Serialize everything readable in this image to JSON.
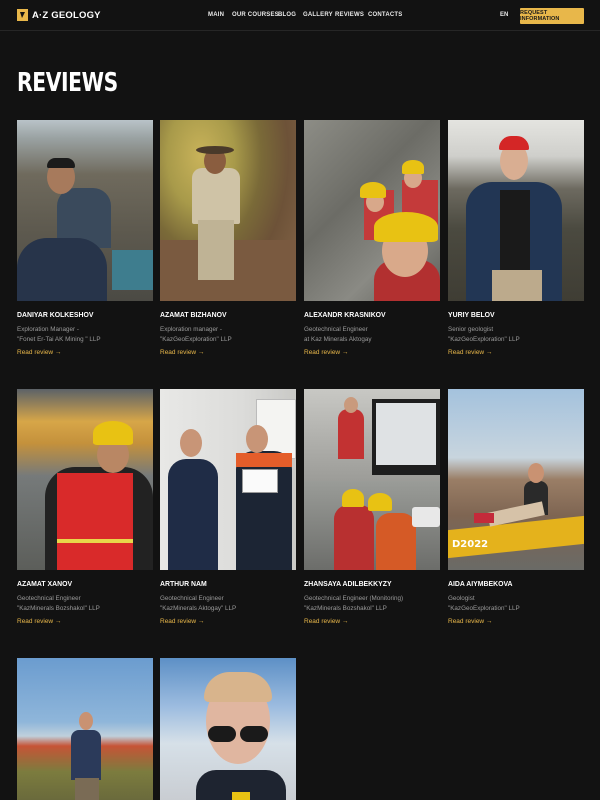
{
  "header": {
    "logo_text": "A·Z GEOLOGY",
    "nav": [
      "MAIN",
      "OUR COURSES",
      "BLOG",
      "GALLERY",
      "REVIEWS",
      "CONTACTS"
    ],
    "lang": "EN",
    "cta_label": "REQUEST INFORMATION"
  },
  "page": {
    "title": "REVIEWS"
  },
  "read_label": "Read review →",
  "reviews": [
    {
      "name": "DANIYAR KOLKESHOV",
      "role1": "Exploration Manager -",
      "role2": "\"Fonet Er-Tai AK Mining \" LLP"
    },
    {
      "name": "AZAMAT BIZHANOV",
      "role1": "Exploration manager -",
      "role2": "\"KazGeoExploration\" LLP"
    },
    {
      "name": "ALEXANDR KRASNIKOV",
      "role1": "Geotechnical Engineer",
      "role2": "at Kaz Minerals Aktogay"
    },
    {
      "name": "YURIY BELOV",
      "role1": "Senior geologist",
      "role2": "\"KazGeoExploration\" LLP"
    },
    {
      "name": "AZAMAT XANOV",
      "role1": "Geotechnical Engineer",
      "role2": "\"KazMinerals Bozshakol\" LLP"
    },
    {
      "name": "ARTHUR NAM",
      "role1": "Geotechnical Engineer",
      "role2": "\"KazMinerals Aktogay\" LLP"
    },
    {
      "name": "ZHANSAYA ADILBEKKYZY",
      "role1": "Geotechnical Engineer (Monitoring)",
      "role2": "\"KazMinerals Bozshakol\" LLP"
    },
    {
      "name": "AIDA AIYMBEKOVA",
      "role1": "Geologist",
      "role2": "\"KazGeoExploration\" LLP"
    }
  ],
  "photo_text": {
    "banner": "D2022"
  },
  "colors": {
    "accent": "#e8b74a",
    "background": "#121212",
    "muted": "#9a9a9a"
  }
}
